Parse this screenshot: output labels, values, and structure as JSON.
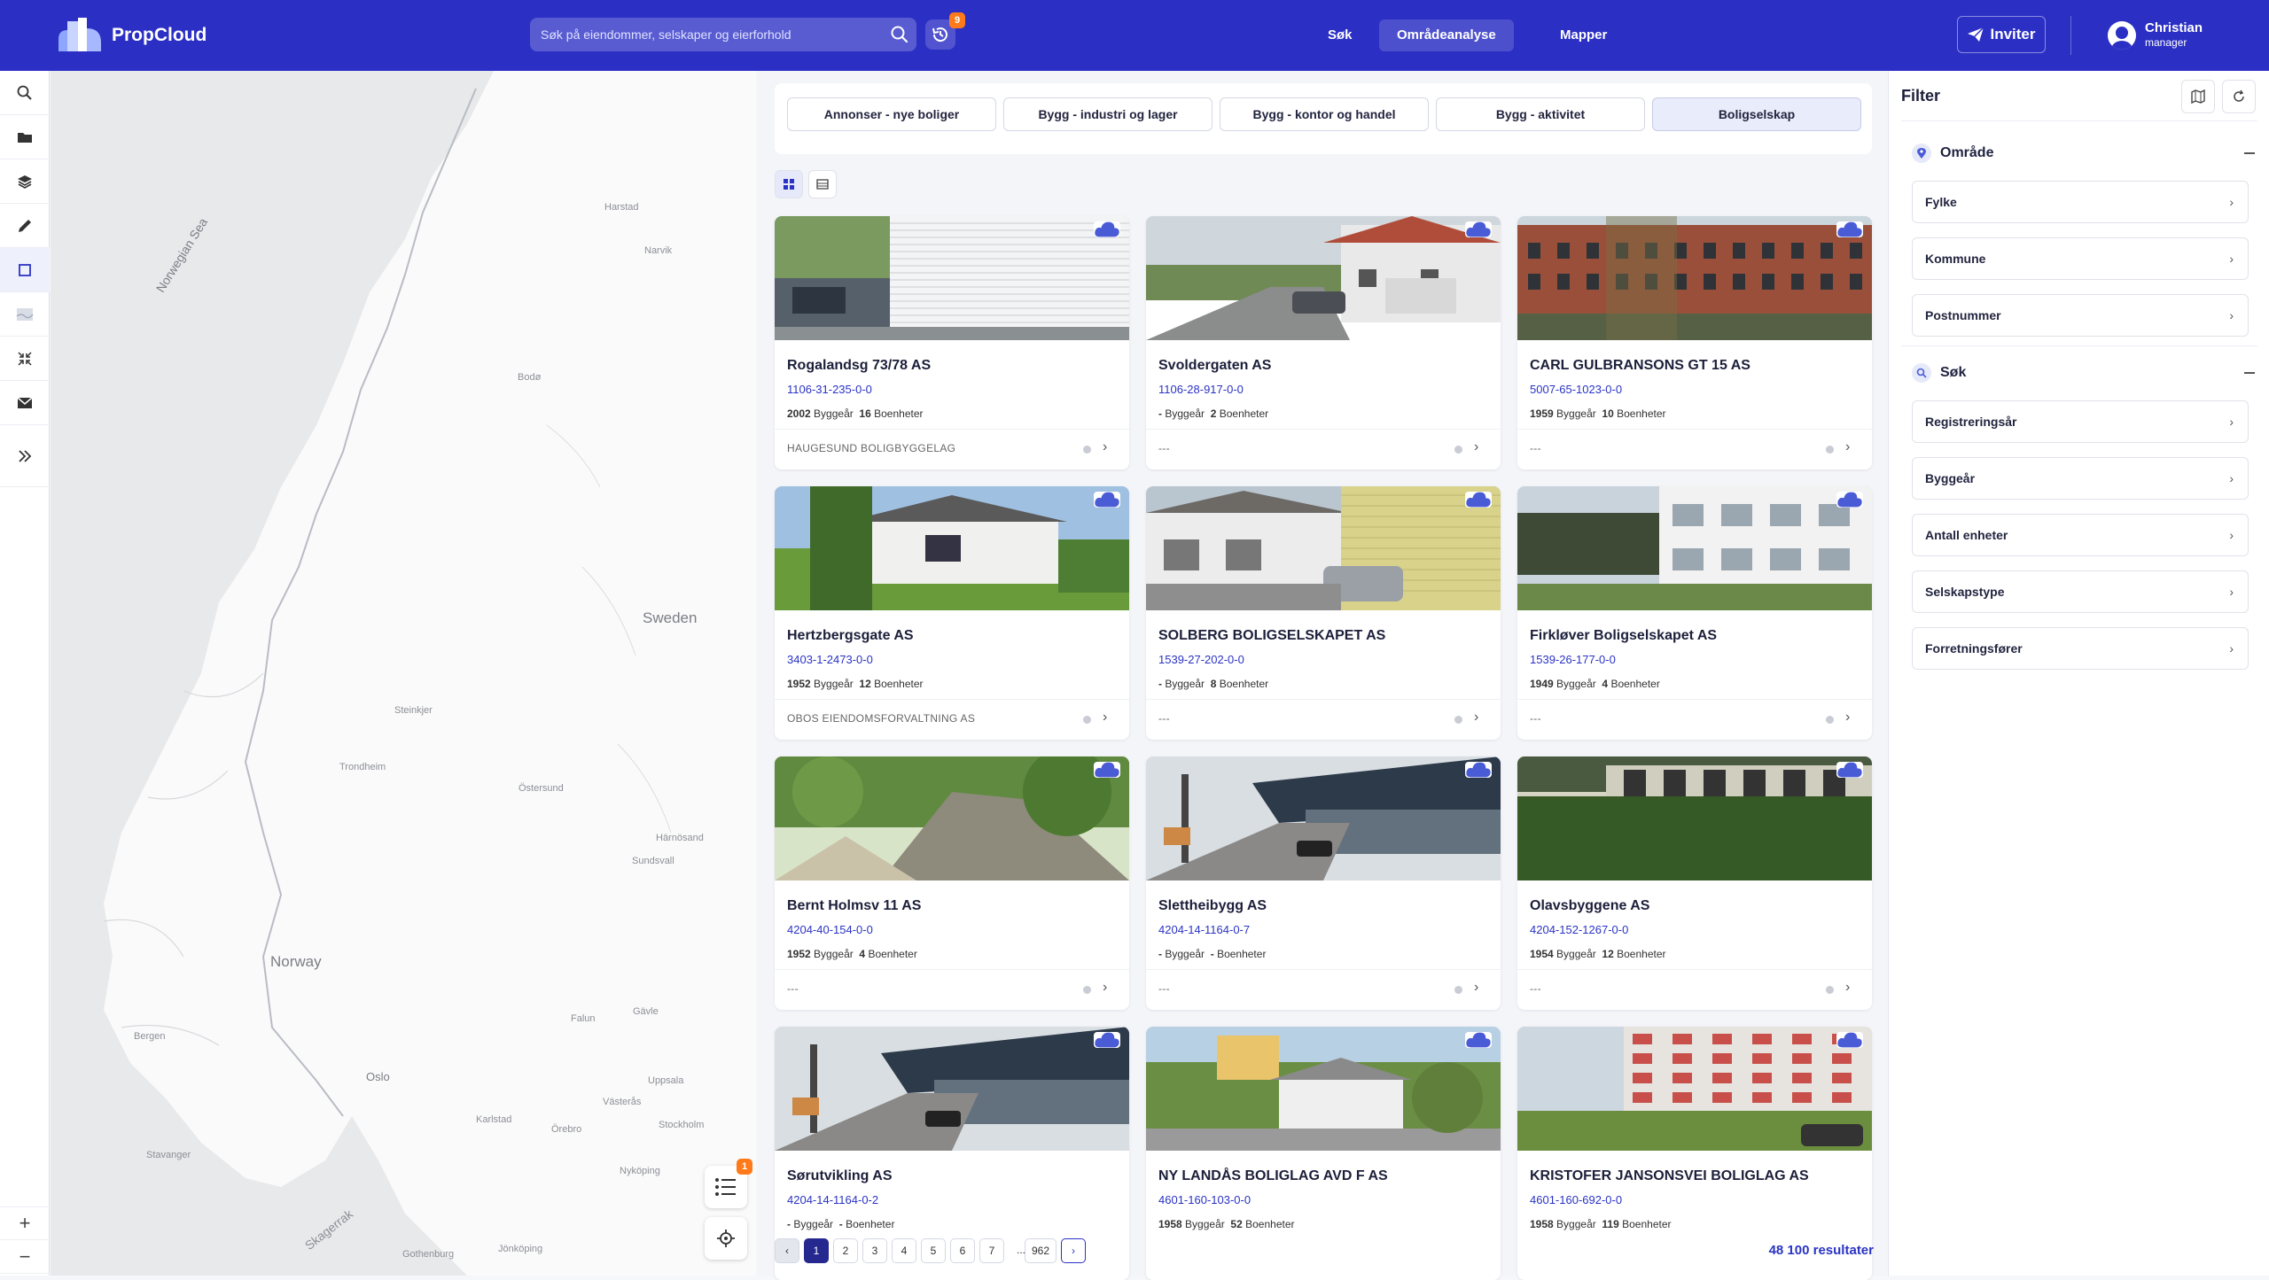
{
  "app": {
    "name": "PropCloud"
  },
  "search": {
    "placeholder": "Søk på eiendommer, selskaper og eierforhold",
    "history_badge": "9"
  },
  "nav": {
    "items": [
      {
        "label": "Søk"
      },
      {
        "label": "Områdeanalyse",
        "active": true
      },
      {
        "label": "Mapper"
      }
    ]
  },
  "invite": {
    "label": "Inviter"
  },
  "user": {
    "name": "Christian",
    "role": "manager"
  },
  "toolbar": {
    "items": [
      "search-icon",
      "folder-icon",
      "layers-icon",
      "pencil-icon",
      "square-icon",
      "map-thumbnail-icon",
      "collapse-icon",
      "mail-check-icon",
      "expand-icon"
    ],
    "zoom_in": "+",
    "zoom_out": "−"
  },
  "map": {
    "labels": [
      {
        "text": "Norwegian Sea",
        "key": "sea"
      },
      {
        "text": "Sweden",
        "key": "sweden"
      },
      {
        "text": "Norway",
        "key": "norway"
      },
      {
        "text": "Skagerrak",
        "key": "skagerrak"
      },
      {
        "text": "Harstad",
        "key": "harstad"
      },
      {
        "text": "Narvik",
        "key": "narvik"
      },
      {
        "text": "Bodø",
        "key": "bodo"
      },
      {
        "text": "Steinkjer",
        "key": "steinkjer"
      },
      {
        "text": "Trondheim",
        "key": "trondheim"
      },
      {
        "text": "Östersund",
        "key": "ostersund"
      },
      {
        "text": "Härnösand",
        "key": "harnosand"
      },
      {
        "text": "Sundsvall",
        "key": "sundsvall"
      },
      {
        "text": "Falun",
        "key": "falun"
      },
      {
        "text": "Gävle",
        "key": "gavle"
      },
      {
        "text": "Bergen",
        "key": "bergen"
      },
      {
        "text": "Oslo",
        "key": "oslo"
      },
      {
        "text": "Uppsala",
        "key": "uppsala"
      },
      {
        "text": "Västerås",
        "key": "vasteras"
      },
      {
        "text": "Karlstad",
        "key": "karlstad"
      },
      {
        "text": "Örebro",
        "key": "orebro"
      },
      {
        "text": "Stockholm",
        "key": "stockholm"
      },
      {
        "text": "Stavanger",
        "key": "stavanger"
      },
      {
        "text": "Nyköping",
        "key": "nykoping"
      },
      {
        "text": "Gothenburg",
        "key": "gothenburg"
      },
      {
        "text": "Jönköping",
        "key": "jonkoping"
      }
    ],
    "list_badge": "1"
  },
  "categories": [
    {
      "label": "Annonser - nye boliger"
    },
    {
      "label": "Bygg - industri og lager"
    },
    {
      "label": "Bygg - kontor og handel"
    },
    {
      "label": "Bygg - aktivitet"
    },
    {
      "label": "Boligselskap",
      "active": true
    }
  ],
  "cards": [
    {
      "title": "Rogalandsg 73/78 AS",
      "id": "1106-31-235-0-0",
      "year": "2002",
      "year_label": "Byggeår",
      "units": "16",
      "units_label": "Boenheter",
      "manager": "HAUGESUND BOLIGBYGGELAG",
      "scene": "wall"
    },
    {
      "title": "Svoldergaten AS",
      "id": "1106-28-917-0-0",
      "year": "-",
      "year_label": "Byggeår",
      "units": "2",
      "units_label": "Boenheter",
      "manager": "---",
      "scene": "street"
    },
    {
      "title": "CARL GULBRANSONS GT 15 AS",
      "id": "5007-65-1023-0-0",
      "year": "1959",
      "year_label": "Byggeår",
      "units": "10",
      "units_label": "Boenheter",
      "manager": "---",
      "scene": "brick"
    },
    {
      "title": "Hertzbergsgate AS",
      "id": "3403-1-2473-0-0",
      "year": "1952",
      "year_label": "Byggeår",
      "units": "12",
      "units_label": "Boenheter",
      "manager": "OBOS EIENDOMSFORVALTNING AS",
      "scene": "house"
    },
    {
      "title": "SOLBERG BOLIGSELSKAPET AS",
      "id": "1539-27-202-0-0",
      "year": "-",
      "year_label": "Byggeår",
      "units": "8",
      "units_label": "Boenheter",
      "manager": "---",
      "scene": "garage"
    },
    {
      "title": "Firkløver Boligselskapet AS",
      "id": "1539-26-177-0-0",
      "year": "1949",
      "year_label": "Byggeår",
      "units": "4",
      "units_label": "Boenheter",
      "manager": "---",
      "scene": "apartment"
    },
    {
      "title": "Bernt Holmsv 11 AS",
      "id": "4204-40-154-0-0",
      "year": "1952",
      "year_label": "Byggeår",
      "units": "4",
      "units_label": "Boenheter",
      "manager": "---",
      "scene": "forest"
    },
    {
      "title": "Slettheibygg AS",
      "id": "4204-14-1164-0-7",
      "year": "-",
      "year_label": "Byggeår",
      "units": "-",
      "units_label": "Boenheter",
      "manager": "---",
      "scene": "market"
    },
    {
      "title": "Olavsbyggene AS",
      "id": "4204-152-1267-0-0",
      "year": "1954",
      "year_label": "Byggeår",
      "units": "12",
      "units_label": "Boenheter",
      "manager": "---",
      "scene": "hedge"
    },
    {
      "title": "Sørutvikling AS",
      "id": "4204-14-1164-0-2",
      "year": "-",
      "year_label": "Byggeår",
      "units": "-",
      "units_label": "Boenheter",
      "manager": "",
      "scene": "market"
    },
    {
      "title": "NY LANDÅS BOLIGLAG AVD F AS",
      "id": "4601-160-103-0-0",
      "year": "1958",
      "year_label": "Byggeår",
      "units": "52",
      "units_label": "Boenheter",
      "manager": "",
      "scene": "yellow"
    },
    {
      "title": "KRISTOFER JANSONSVEI BOLIGLAG AS",
      "id": "4601-160-692-0-0",
      "year": "1958",
      "year_label": "Byggeår",
      "units": "119",
      "units_label": "Boenheter",
      "manager": "",
      "scene": "block"
    }
  ],
  "pagination": {
    "pages": [
      "1",
      "2",
      "3",
      "4",
      "5",
      "6",
      "7"
    ],
    "ellipsis": "...",
    "last": "962",
    "current": "1",
    "prev": "‹",
    "next": "›"
  },
  "results": {
    "label": "48 100 resultater"
  },
  "filter": {
    "title": "Filter",
    "sections": [
      {
        "title": "Område",
        "icon": "pin-icon",
        "items": [
          "Fylke",
          "Kommune",
          "Postnummer"
        ]
      },
      {
        "title": "Søk",
        "icon": "search-icon",
        "items": [
          "Registreringsår",
          "Byggeår",
          "Antall enheter",
          "Selskapstype",
          "Forretningsfører"
        ]
      }
    ]
  }
}
